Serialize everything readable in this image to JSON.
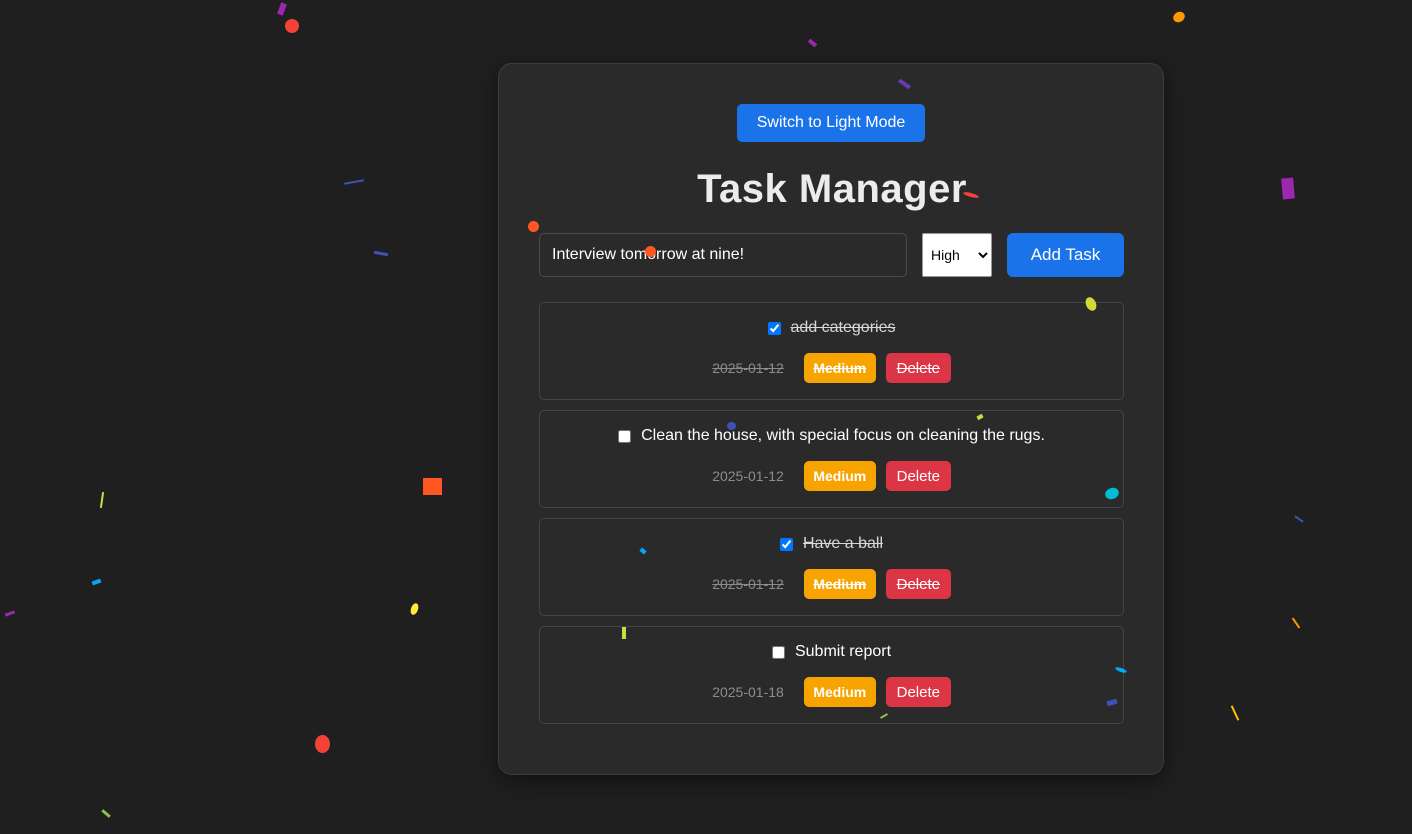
{
  "theme": {
    "toggle_label": "Switch to Light Mode",
    "accent": "#1a73e8",
    "background": "#1f1f1f"
  },
  "app": {
    "title": "Task Manager"
  },
  "new_task": {
    "input_value": "Interview tomorrow at nine!",
    "priority_selected": "High",
    "add_label": "Add Task"
  },
  "tasks": [
    {
      "text": "add categories",
      "date": "2025-01-12",
      "priority": "Medium",
      "completed": true,
      "delete_label": "Delete"
    },
    {
      "text": "Clean the house, with special focus on cleaning the rugs.",
      "date": "2025-01-12",
      "priority": "Medium",
      "completed": false,
      "delete_label": "Delete"
    },
    {
      "text": "Have a ball",
      "date": "2025-01-12",
      "priority": "Medium",
      "completed": true,
      "delete_label": "Delete"
    },
    {
      "text": "Submit report",
      "date": "2025-01-18",
      "priority": "Medium",
      "completed": false,
      "delete_label": "Delete"
    }
  ],
  "colors": {
    "priority_medium": "#f7a400",
    "delete": "#dc3545"
  }
}
